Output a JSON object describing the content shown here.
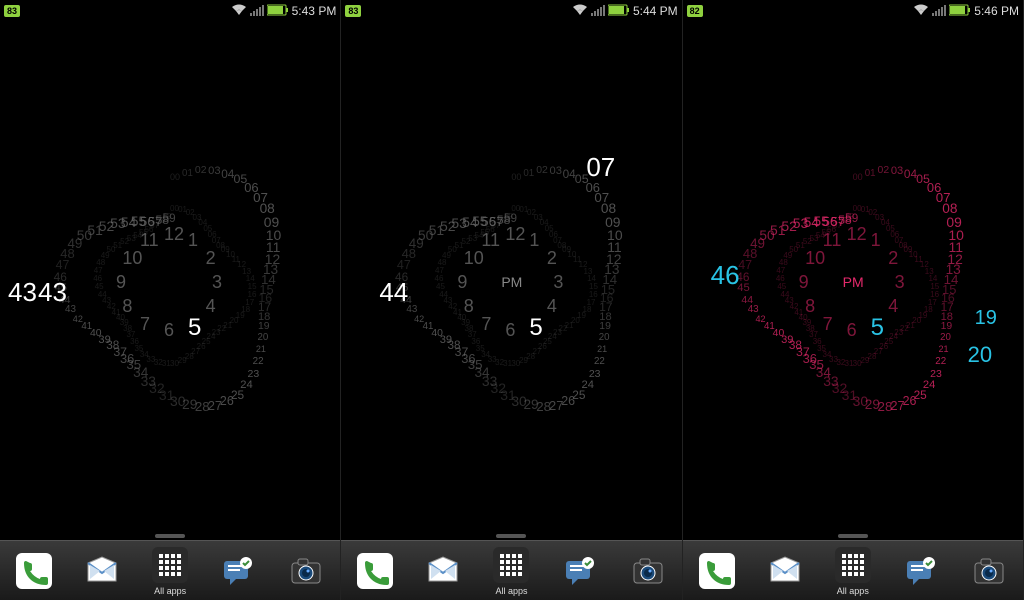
{
  "phones": [
    {
      "battery": "83",
      "time": "5:43 PM",
      "hour": "5",
      "minute": "43",
      "second": "43",
      "showSecond": true,
      "showPM": false,
      "color": "#fff",
      "ringColor": "#888",
      "spiralColor": "#666"
    },
    {
      "battery": "83",
      "time": "5:44 PM",
      "hour": "5",
      "minute": "44",
      "second": "07",
      "showSecond": true,
      "showPM": true,
      "color": "#fff",
      "ringColor": "#888",
      "spiralColor": "#666",
      "secPos": "tr"
    },
    {
      "battery": "82",
      "time": "5:46 PM",
      "hour": "5",
      "minute": "46",
      "second": "20",
      "showSecond": true,
      "showPM": true,
      "color": "#29c3e5",
      "ringColor": "#e5296b",
      "spiralColor": "#e5296b",
      "secPos": "br",
      "hourColor": "#e5296b",
      "minColor": "#29c3e5"
    }
  ],
  "dock": {
    "allapps": "All apps"
  },
  "status_icons": {
    "wifi": "wifi-icon",
    "signal": "signal-icon",
    "battery": "battery-icon"
  }
}
